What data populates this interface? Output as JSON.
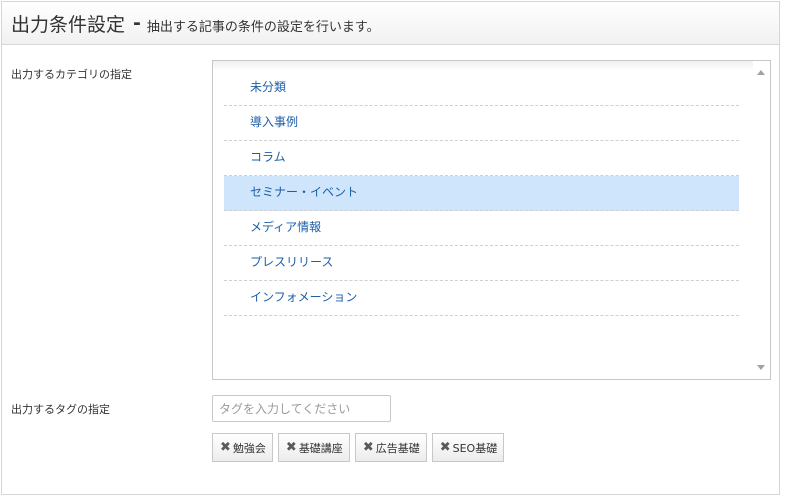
{
  "header": {
    "title": "出力条件設定",
    "separator": "-",
    "description": "抽出する記事の条件の設定を行います。"
  },
  "category": {
    "label": "出力するカテゴリの指定",
    "items": [
      {
        "label": "未分類",
        "selected": false
      },
      {
        "label": "導入事例",
        "selected": false
      },
      {
        "label": "コラム",
        "selected": false
      },
      {
        "label": "セミナー・イベント",
        "selected": true
      },
      {
        "label": "メディア情報",
        "selected": false
      },
      {
        "label": "プレスリリース",
        "selected": false
      },
      {
        "label": "インフォメーション",
        "selected": false
      }
    ]
  },
  "tag": {
    "label": "出力するタグの指定",
    "placeholder": "タグを入力してください",
    "value": "",
    "remove_glyph": "✖",
    "tags": [
      "勉強会",
      "基礎講座",
      "広告基礎",
      "SEO基礎"
    ]
  },
  "colors": {
    "link": "#1e5fa8",
    "selected_bg": "#cfe5fb"
  }
}
